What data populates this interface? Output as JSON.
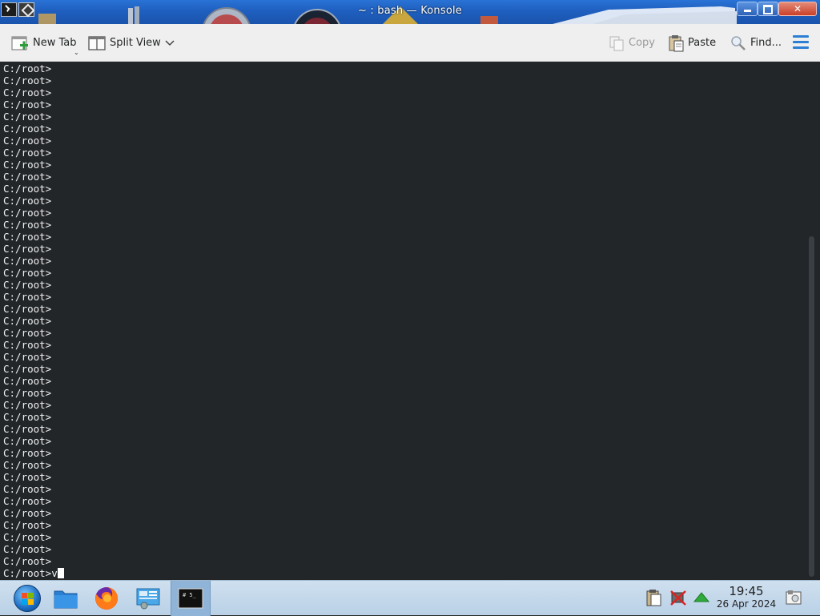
{
  "window": {
    "title": "~ : bash — Konsole"
  },
  "toolbar": {
    "new_tab_label": "New Tab",
    "split_view_label": "Split View",
    "copy_label": "Copy",
    "paste_label": "Paste",
    "find_label": "Find..."
  },
  "terminal": {
    "prompt_lines": [
      "C:/root>",
      "C:/root>",
      "C:/root>",
      "C:/root>",
      "C:/root>",
      "C:/root>",
      "C:/root>",
      "C:/root>",
      "C:/root>",
      "C:/root>",
      "C:/root>",
      "C:/root>",
      "C:/root>",
      "C:/root>",
      "C:/root>",
      "C:/root>",
      "C:/root>",
      "C:/root>",
      "C:/root>",
      "C:/root>",
      "C:/root>",
      "C:/root>",
      "C:/root>",
      "C:/root>",
      "C:/root>",
      "C:/root>",
      "C:/root>",
      "C:/root>",
      "C:/root>",
      "C:/root>",
      "C:/root>",
      "C:/root>",
      "C:/root>",
      "C:/root>",
      "C:/root>",
      "C:/root>",
      "C:/root>",
      "C:/root>",
      "C:/root>",
      "C:/root>",
      "C:/root>",
      "C:/root>"
    ],
    "current_line": "C:/root>v"
  },
  "taskbar": {
    "konsole_thumb_label": "# 5_"
  },
  "clock": {
    "time": "19:45",
    "date": "26 Apr 2024"
  },
  "colors": {
    "terminal_bg": "#232629",
    "terminal_fg": "#eff0f1",
    "titlebar": "#1f5fbf",
    "accent": "#2d7fd4"
  },
  "icons": {
    "new_tab": "new-tab-icon",
    "split_view": "split-view-icon",
    "copy": "copy-icon",
    "paste": "paste-icon",
    "find": "magnifier-icon",
    "menu": "hamburger-menu-icon"
  }
}
